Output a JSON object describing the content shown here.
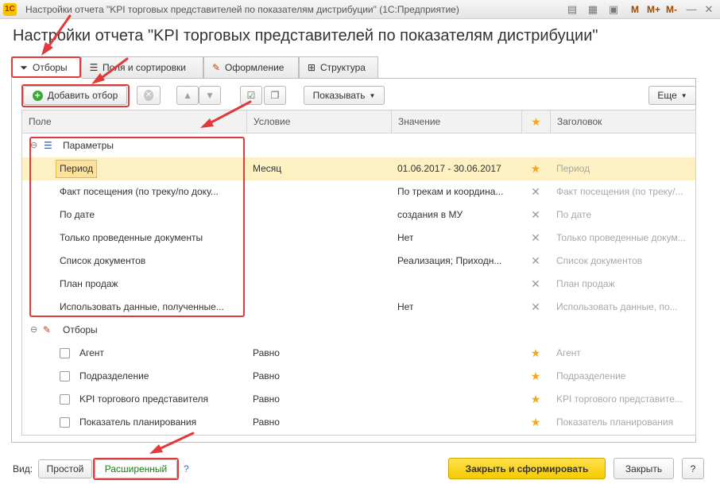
{
  "window": {
    "title": "Настройки отчета \"KPI торговых представителей по показателям дистрибуции\"  (1С:Предприятие)",
    "logo": "1С",
    "mem_labels": [
      "M",
      "M+",
      "M-"
    ]
  },
  "page": {
    "title": "Настройки отчета \"KPI торговых представителей по показателям дистрибуции\""
  },
  "tabs": [
    {
      "label": "Отборы",
      "icon": "filter-icon",
      "active": true
    },
    {
      "label": "Поля и сортировки",
      "icon": "fields-icon",
      "active": false
    },
    {
      "label": "Оформление",
      "icon": "brush-icon",
      "active": false
    },
    {
      "label": "Структура",
      "icon": "structure-icon",
      "active": false
    }
  ],
  "toolbar": {
    "add_filter": "Добавить отбор",
    "show": "Показывать",
    "more": "Еще"
  },
  "table": {
    "columns": [
      "Поле",
      "Условие",
      "Значение",
      "Заголовок"
    ],
    "groups": [
      {
        "label": "Параметры",
        "rows": [
          {
            "field": "Период",
            "condition": "Месяц",
            "value": "01.06.2017 - 30.06.2017",
            "mark": "star",
            "caption": "Период",
            "selected": true
          },
          {
            "field": "Факт посещения (по треку/по доку...",
            "condition": "",
            "value": "По трекам и координа...",
            "mark": "x",
            "caption": "Факт посещения (по треку/..."
          },
          {
            "field": "По дате",
            "condition": "",
            "value": "создания в МУ",
            "mark": "x",
            "caption": "По дате"
          },
          {
            "field": "Только проведенные документы",
            "condition": "",
            "value": "Нет",
            "mark": "x",
            "caption": "Только проведенные докум..."
          },
          {
            "field": "Список документов",
            "condition": "",
            "value": "Реализация; Приходн...",
            "mark": "x",
            "caption": "Список документов"
          },
          {
            "field": "План продаж",
            "condition": "",
            "value": "",
            "mark": "x",
            "caption": "План продаж"
          },
          {
            "field": "Использовать данные, полученные...",
            "condition": "",
            "value": "Нет",
            "mark": "x",
            "caption": "Использовать данные, по..."
          }
        ]
      },
      {
        "label": "Отборы",
        "rows": [
          {
            "field": "Агент",
            "condition": "Равно",
            "value": "",
            "mark": "star",
            "caption": "Агент"
          },
          {
            "field": "Подразделение",
            "condition": "Равно",
            "value": "",
            "mark": "star",
            "caption": "Подразделение"
          },
          {
            "field": "KPI торгового представителя",
            "condition": "Равно",
            "value": "",
            "mark": "star",
            "caption": "KPI торгового представите..."
          },
          {
            "field": "Показатель планирования",
            "condition": "Равно",
            "value": "",
            "mark": "star",
            "caption": "Показатель планирования"
          }
        ]
      }
    ]
  },
  "footer": {
    "view_label": "Вид:",
    "simple": "Простой",
    "advanced": "Расширенный",
    "help": "?",
    "close_generate": "Закрыть и сформировать",
    "close": "Закрыть",
    "question": "?"
  },
  "colors": {
    "accent_red": "#e03a3a",
    "primary_yellow": "#f5cb00",
    "selected_row": "#fdf0c2",
    "star": "#f2a81d"
  }
}
